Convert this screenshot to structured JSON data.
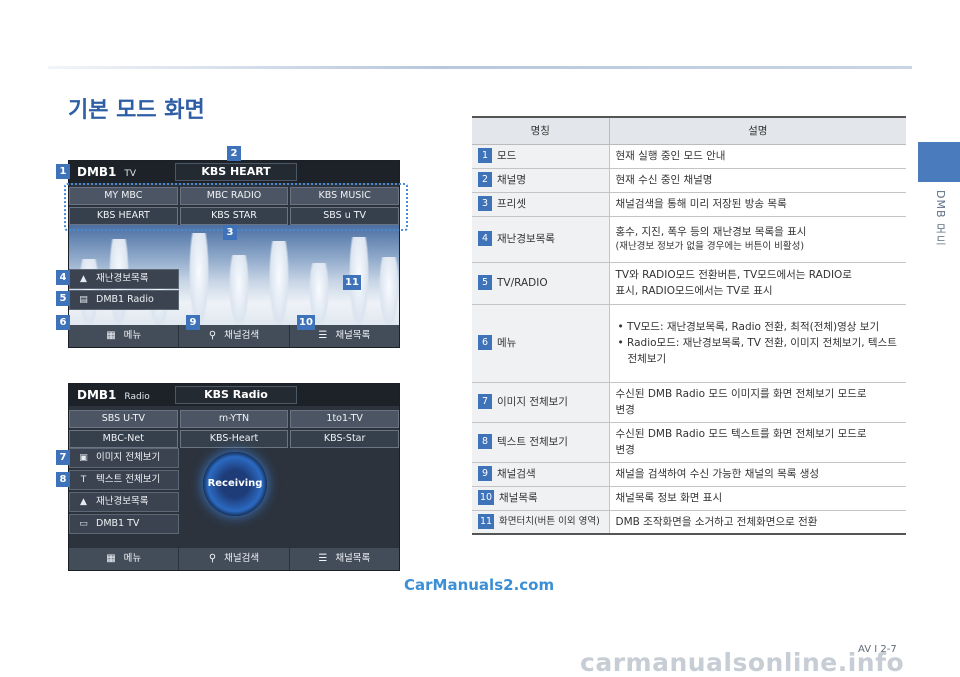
{
  "header": {
    "title": "기본 모드 화면",
    "side_label": "DMB 모드"
  },
  "colors": {
    "accent": "#3e72b9",
    "title": "#2e5fa6",
    "table_header_bg": "#e3e6ea"
  },
  "screen_tv": {
    "brand": "DMB1",
    "mode": "TV",
    "channel": "KBS HEART",
    "channels": [
      "MY MBC",
      "MBC RADIO",
      "KBS MUSIC",
      "KBS HEART",
      "KBS STAR",
      "SBS u TV"
    ],
    "panel": [
      "재난경보목록",
      "DMB1 Radio"
    ],
    "bottom": [
      "메뉴",
      "채널검색",
      "채널목록"
    ]
  },
  "screen_radio": {
    "brand": "DMB1",
    "mode": "Radio",
    "channel": "KBS Radio",
    "channels": [
      "SBS U-TV",
      "m-YTN",
      "1to1-TV",
      "MBC-Net",
      "KBS-Heart",
      "KBS-Star"
    ],
    "receiving": "Receiving",
    "panel": [
      "이미지 전체보기",
      "텍스트 전체보기",
      "재난경보목록",
      "DMB1 TV"
    ],
    "bottom": [
      "메뉴",
      "채널검색",
      "채널목록"
    ]
  },
  "markers": [
    "1",
    "2",
    "3",
    "4",
    "5",
    "6",
    "9",
    "10",
    "11",
    "7",
    "8"
  ],
  "table": {
    "headers": [
      "명칭",
      "설명"
    ],
    "rows": [
      {
        "num": "1",
        "name": "모드",
        "desc": [
          "현재 실행 중인 모드 안내"
        ]
      },
      {
        "num": "2",
        "name": "채널명",
        "desc": [
          "현재 수신 중인 채널명"
        ]
      },
      {
        "num": "3",
        "name": "프리셋",
        "desc": [
          "채널검색을 통해 미리 저장된 방송 목록"
        ]
      },
      {
        "num": "4",
        "name": "재난경보목록",
        "desc": [
          "홍수, 지진, 폭우 등의 재난경보 목록을 표시",
          "(재난경보 정보가 없을 경우에는 버튼이 비활성)"
        ]
      },
      {
        "num": "5",
        "name": "TV/RADIO",
        "desc": [
          "TV와 RADIO모드 전환버튼, TV모드에서는 RADIO로",
          "표시, RADIO모드에서는 TV로 표시"
        ]
      },
      {
        "num": "6",
        "name": "메뉴",
        "desc": [
          "• TV모드: 재난경보목록, Radio 전환, 최적(전체)영상 보기",
          "• Radio모드: 재난경보목록, TV 전환, 이미지 전체보기, 텍스트 전체보기"
        ]
      },
      {
        "num": "7",
        "name": "이미지 전체보기",
        "desc": [
          "수신된 DMB Radio 모드 이미지를 화면 전체보기 모드로",
          "변경"
        ]
      },
      {
        "num": "8",
        "name": "텍스트 전체보기",
        "desc": [
          "수신된 DMB Radio 모드 텍스트를 화면 전체보기 모드로",
          "변경"
        ]
      },
      {
        "num": "9",
        "name": "채널검색",
        "desc": [
          "채널을 검색하여 수신 가능한 채널의 목록 생성"
        ]
      },
      {
        "num": "10",
        "name": "채널목록",
        "desc": [
          "채널목록 정보 화면 표시"
        ]
      },
      {
        "num": "11",
        "name": "화면터치(버튼 이외 영역)",
        "desc": [
          "DMB 조작화면을 소거하고 전체화면으로 전환"
        ]
      }
    ]
  },
  "footer": {
    "page_number": "AV I 2-7",
    "watermark": "CarManuals2.com",
    "watermark2": "carmanualsonline.info"
  }
}
